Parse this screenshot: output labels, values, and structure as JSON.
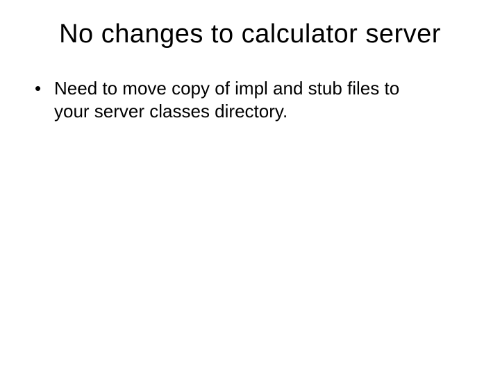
{
  "slide": {
    "title": "No changes to calculator server",
    "bullets": [
      "Need to move copy of impl and stub files to your server classes directory."
    ]
  }
}
